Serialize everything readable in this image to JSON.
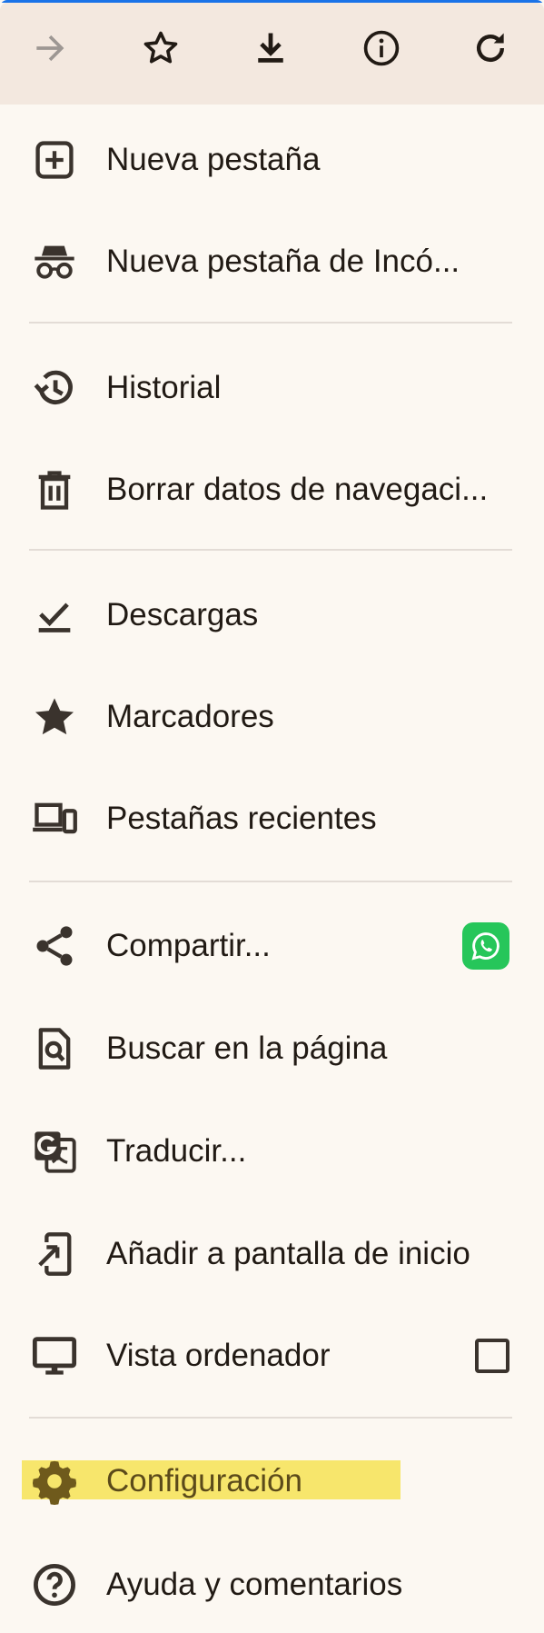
{
  "toolbar": {
    "buttons": [
      {
        "name": "forward-icon"
      },
      {
        "name": "star-outline-icon"
      },
      {
        "name": "download-icon"
      },
      {
        "name": "info-icon"
      },
      {
        "name": "refresh-icon"
      }
    ]
  },
  "menu": {
    "new_tab": "Nueva pestaña",
    "new_incognito_tab": "Nueva pestaña de Incó...",
    "history": "Historial",
    "clear_browsing_data": "Borrar datos de navegaci...",
    "downloads": "Descargas",
    "bookmarks": "Marcadores",
    "recent_tabs": "Pestañas recientes",
    "share": "Compartir...",
    "find_in_page": "Buscar en la página",
    "translate": "Traducir...",
    "add_to_home": "Añadir a pantalla de inicio",
    "desktop_site": "Vista ordenador",
    "settings": "Configuración",
    "help": "Ayuda y comentarios"
  },
  "desktop_site_checked": false,
  "colors": {
    "background": "#fcf8f2",
    "toolbar": "#f3e8df",
    "highlight": "#f7e66c",
    "whatsapp": "#26c65a",
    "icon": "#3a332d"
  }
}
